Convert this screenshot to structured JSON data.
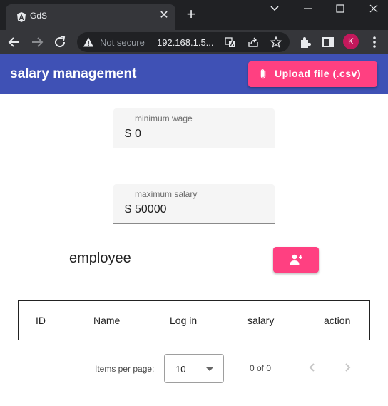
{
  "browser": {
    "tab_title": "GdS",
    "not_secure_label": "Not secure",
    "url": "192.168.1.5..."
  },
  "profile_initial": "K",
  "app": {
    "title": "salary management",
    "upload_label": "Upload file (.csv)"
  },
  "fields": {
    "minimum": {
      "label": "minimum wage",
      "prefix": "$",
      "value": "0"
    },
    "maximum": {
      "label": "maximum salary",
      "prefix": "$",
      "value": "50000"
    }
  },
  "employee": {
    "title": "employee"
  },
  "table": {
    "columns": [
      "ID",
      "Name",
      "Log in",
      "salary",
      "action"
    ]
  },
  "paginator": {
    "items_label": "Items per page:",
    "page_size": "10",
    "range": "0 of 0"
  },
  "colors": {
    "primary": "#3f51b5",
    "accent": "#ff4081"
  }
}
